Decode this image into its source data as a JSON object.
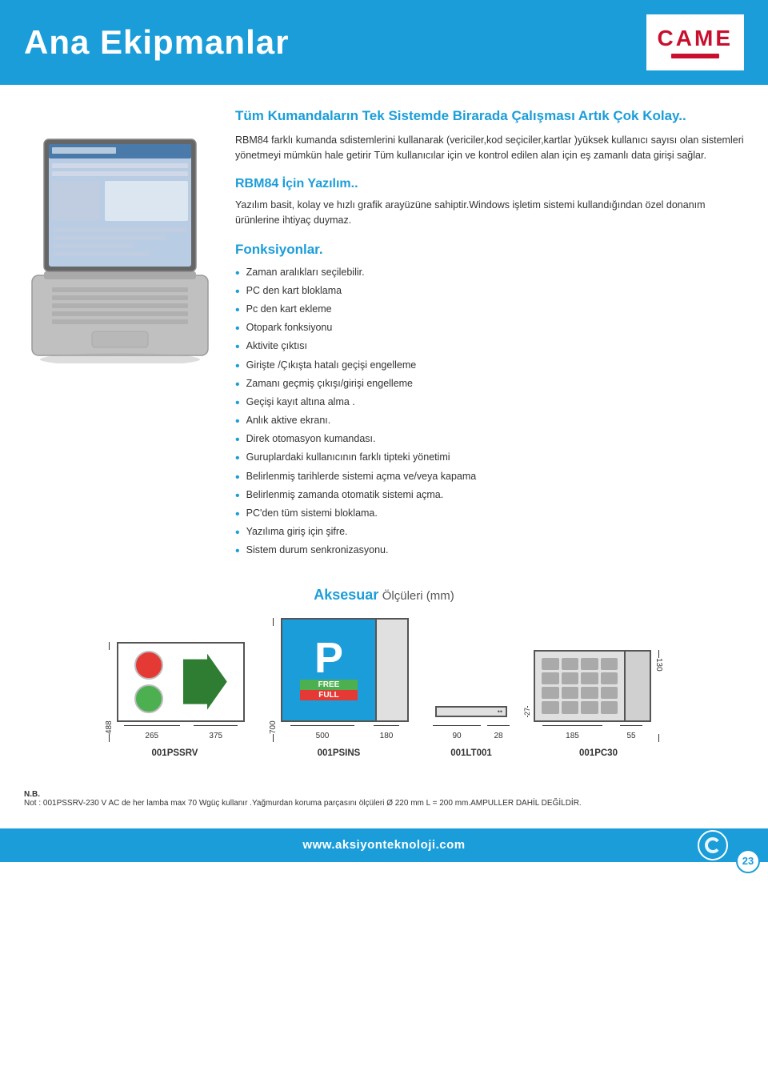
{
  "header": {
    "title": "Ana Ekipmanlar",
    "logo_text": "CAME",
    "logo_bar_color": "#c8102e"
  },
  "main": {
    "section1": {
      "title": "Tüm Kumandaların Tek Sistemde Birarada Çalışması Artık Çok Kolay..",
      "body": "RBM84 farklı kumanda sdistemlerini kullanarak (vericiler,kod seçiciler,kartlar )yüksek kullanıcı sayısı olan sistemleri yönetmeyi mümkün hale getirir Tüm kullanıcılar için ve kontrol edilen alan için eş zamanlı data girişi sağlar."
    },
    "section2": {
      "title": "RBM84 İçin Yazılım..",
      "body": "Yazılım basit, kolay ve hızlı grafik arayüzüne sahiptir.Windows işletim sistemi kullandığından özel donanım ürünlerine ihtiyaç duymaz."
    },
    "section3": {
      "title": "Fonksiyonlar.",
      "bullets": [
        "Zaman aralıkları seçilebilir.",
        "PC den kart bloklama",
        "Pc den kart ekleme",
        "Otopark fonksiyonu",
        "Aktivite çıktısı",
        "Girişte /Çıkışta hatalı geçişi engelleme",
        "Zamanı geçmiş çıkışı/girişi engelleme",
        "Geçişi kayıt altına alma .",
        "Anlık aktive ekranı.",
        "Direk otomasyon kumandası.",
        "Guruplardaki kullanıcının farklı tipteki yönetimi",
        "Belirlenmiş tarihlerde sistemi açma ve/veya kapama",
        "Belirlenmiş zamanda otomatik sistemi açma.",
        "PC'den tüm sistemi bloklama.",
        "Yazılıma giriş için şifre.",
        "Sistem durum senkronizasyonu."
      ]
    }
  },
  "accessories": {
    "title_main": "Aksesuar",
    "title_sub": "Ölçüleri  (mm)",
    "items": [
      {
        "code": "001PSSRV",
        "dims": {
          "height": "488",
          "w1": "265",
          "w2": "375"
        }
      },
      {
        "code": "001PSINS",
        "dims": {
          "height": "700",
          "w1": "500",
          "w2": "180"
        }
      },
      {
        "code": "001LT001",
        "dims": {
          "h": "27",
          "w1": "90",
          "w2": "28"
        }
      },
      {
        "code": "001PC30",
        "dims": {
          "height": "130",
          "w1": "185",
          "w2": "55"
        }
      }
    ]
  },
  "footer": {
    "note_label": "N.B.",
    "note_text": "Not : 001PSSRV-230 V AC de her lamba max 70 Wgüç kullanır .Yağmurdan koruma parçasını ölçüleri Ø 220 mm L = 200 mm.AMPULLER DAHİL DEĞİLDİR.",
    "url": "www.aksiyonteknoloji.com",
    "page_number": "23"
  }
}
